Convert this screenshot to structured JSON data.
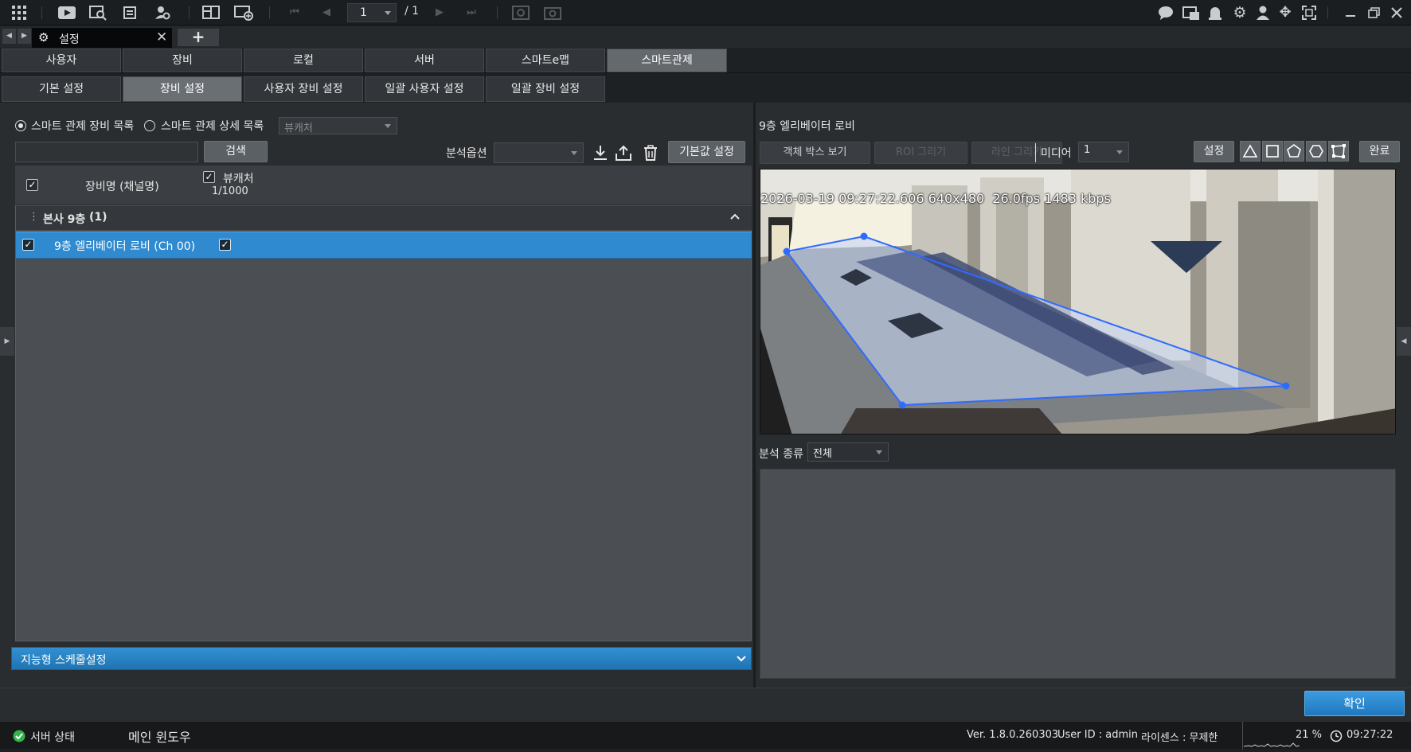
{
  "toolbar": {
    "page_current": "1",
    "page_total": "/ 1",
    "icons": [
      "apps-grid-icon",
      "live-view-icon",
      "playback-search-icon",
      "event-search-icon",
      "person-search-icon",
      "layout-icon",
      "add-screen-icon",
      "first-page-icon",
      "prev-page-icon",
      "next-page-icon",
      "last-page-icon",
      "snapshot-icon",
      "record-icon",
      "chat-icon",
      "message-icon",
      "alarm-icon",
      "settings-icon",
      "user-icon",
      "move-icon",
      "fullscreen-icon",
      "minimize-icon",
      "restore-icon",
      "close-icon"
    ]
  },
  "tabstrip": {
    "active_tab": "설정",
    "close": "✕",
    "add": "+"
  },
  "main_tabs": [
    "사용자",
    "장비",
    "로컬",
    "서버",
    "스마트e맵",
    "스마트관제"
  ],
  "sub_tabs": [
    "기본 설정",
    "장비 설정",
    "사용자 장비 설정",
    "일괄 사용자 설정",
    "일괄 장비 설정"
  ],
  "left": {
    "radio_device_list": "스마트 관제 장비 목록",
    "radio_detail_list": "스마트 관제 상세 목록",
    "detail_combo": "뷰캐처",
    "search_value": "",
    "search_button": "검색",
    "analysis_option_label": "분석옵션",
    "analysis_option_value": "",
    "default_button": "기본값 설정",
    "grid": {
      "col_name": "장비명 (채널명)",
      "col_viewcatcher": "뷰캐처",
      "col_viewcatcher_count": "1/1000",
      "group_label": "본사 9층",
      "group_count": "(1)",
      "row_name": "9층 엘리베이터 로비 (Ch 00)"
    },
    "schedule_bar": "지능형 스케줄설정"
  },
  "right": {
    "title": "9층 엘리베이터 로비",
    "object_box_btn": "객체 박스 보기",
    "roi_btn": "ROI 그리기",
    "line_btn": "라인 그리기",
    "media_label": "미디어",
    "media_value": "1",
    "settings_btn": "설정",
    "done_btn": "완료",
    "overlay": "2026-03-19 09:27:22.606 640x480  26.0fps 1483 kbps",
    "analysis_type_label": "분석 종류",
    "analysis_type_value": "전체"
  },
  "footer": {
    "ok": "확인"
  },
  "status": {
    "server_status": "서버 상태",
    "main_window": "메인 윈도우",
    "version": "Ver. 1.8.0.260303",
    "user": "User ID : admin",
    "license": "라이센스 : 무제한",
    "cpu": "21 %",
    "time": "09:27:22"
  },
  "colors": {
    "accent": "#2f8ad0",
    "roi": "#2f6bff"
  }
}
